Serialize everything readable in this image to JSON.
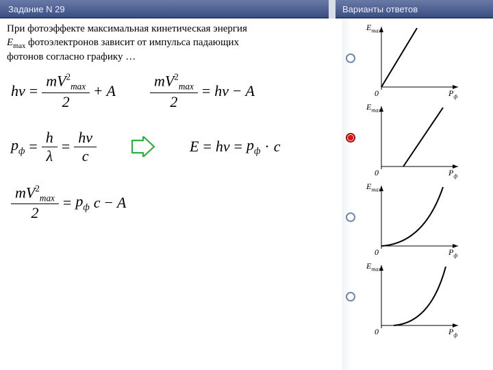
{
  "header": {
    "task_label": "Задание N 29",
    "answers_label": "Варианты ответов"
  },
  "question": {
    "line1": "При фотоэффекте максимальная кинетическая энергия",
    "var_html": "E_max",
    "line2": "фотоэлектронов зависит от импульса падающих",
    "line3": "фотонов согласно графику …"
  },
  "formulas": {
    "hnu": "hν",
    "mV2": "mV",
    "max": "max",
    "A": "A",
    "plus": "+",
    "minus": "−",
    "eq": "=",
    "two": "2",
    "sup2": "2",
    "p": "p",
    "phi": "ф",
    "h": "h",
    "lambda": "λ",
    "c": "c",
    "E": "E",
    "dot": "·"
  },
  "axes": {
    "y": "E_max",
    "x": "P_ф",
    "zero": "0"
  },
  "answers": {
    "selected_index": 1,
    "items": [
      {
        "type": "linear_through_origin"
      },
      {
        "type": "linear_offset_positive_x"
      },
      {
        "type": "concave_up_1"
      },
      {
        "type": "concave_up_2"
      }
    ]
  }
}
